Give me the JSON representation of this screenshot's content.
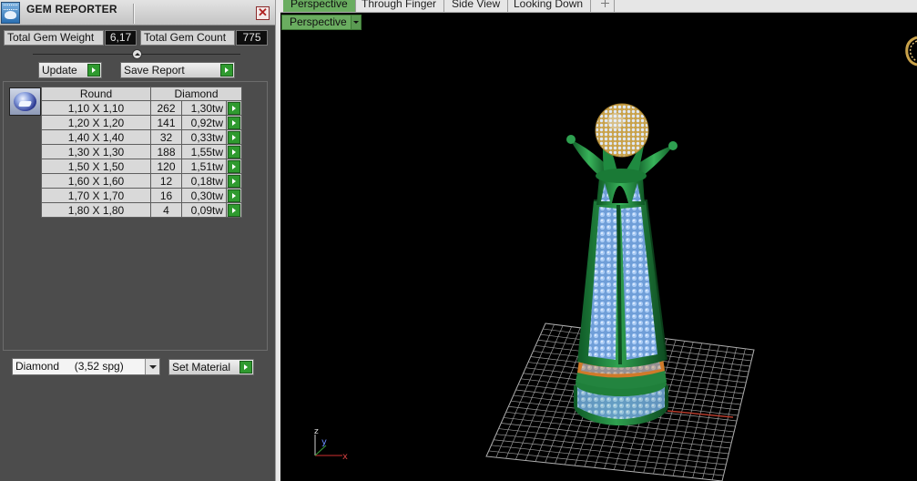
{
  "panel": {
    "title": "GEM REPORTER",
    "close_glyph": "✕",
    "total_weight_label": "Total Gem Weight",
    "total_weight_value": "6,17",
    "total_count_label": "Total Gem Count",
    "total_count_value": "775",
    "update_label": "Update",
    "save_report_label": "Save Report",
    "table": {
      "headers": [
        "Round",
        "Diamond"
      ],
      "rows": [
        {
          "size": "1,10 X 1,10",
          "count": "262",
          "weight": "1,30tw"
        },
        {
          "size": "1,20 X 1,20",
          "count": "141",
          "weight": "0,92tw"
        },
        {
          "size": "1,40 X 1,40",
          "count": "32",
          "weight": "0,33tw"
        },
        {
          "size": "1,30 X 1,30",
          "count": "188",
          "weight": "1,55tw"
        },
        {
          "size": "1,50 X 1,50",
          "count": "120",
          "weight": "1,51tw"
        },
        {
          "size": "1,60 X 1,60",
          "count": "12",
          "weight": "0,18tw"
        },
        {
          "size": "1,70 X 1,70",
          "count": "16",
          "weight": "0,30tw"
        },
        {
          "size": "1,80 X 1,80",
          "count": "4",
          "weight": "0,09tw"
        }
      ]
    },
    "material_value": "Diamond     (3,52 spg)",
    "set_material_label": "Set Material"
  },
  "viewport": {
    "tabs": [
      "Perspective",
      "Through Finger",
      "Side View",
      "Looking Down"
    ],
    "active_tab": "Perspective",
    "view_mode": "Perspective",
    "axis_labels": {
      "z": "z",
      "y": "y",
      "x": "x"
    }
  },
  "colors": {
    "active_tab": "#6aad60",
    "go_button": "#2f9a2f",
    "model_green": "#1f7f3a",
    "gem_blue": "#8fb8f0",
    "gold": "#d9b25a"
  },
  "icons": [
    "gem-reporter-icon",
    "close-icon",
    "play-arrow-icon",
    "gem-thumbnail",
    "dropdown-arrow-icon",
    "add-tab-icon",
    "axis-gizmo-icon"
  ]
}
